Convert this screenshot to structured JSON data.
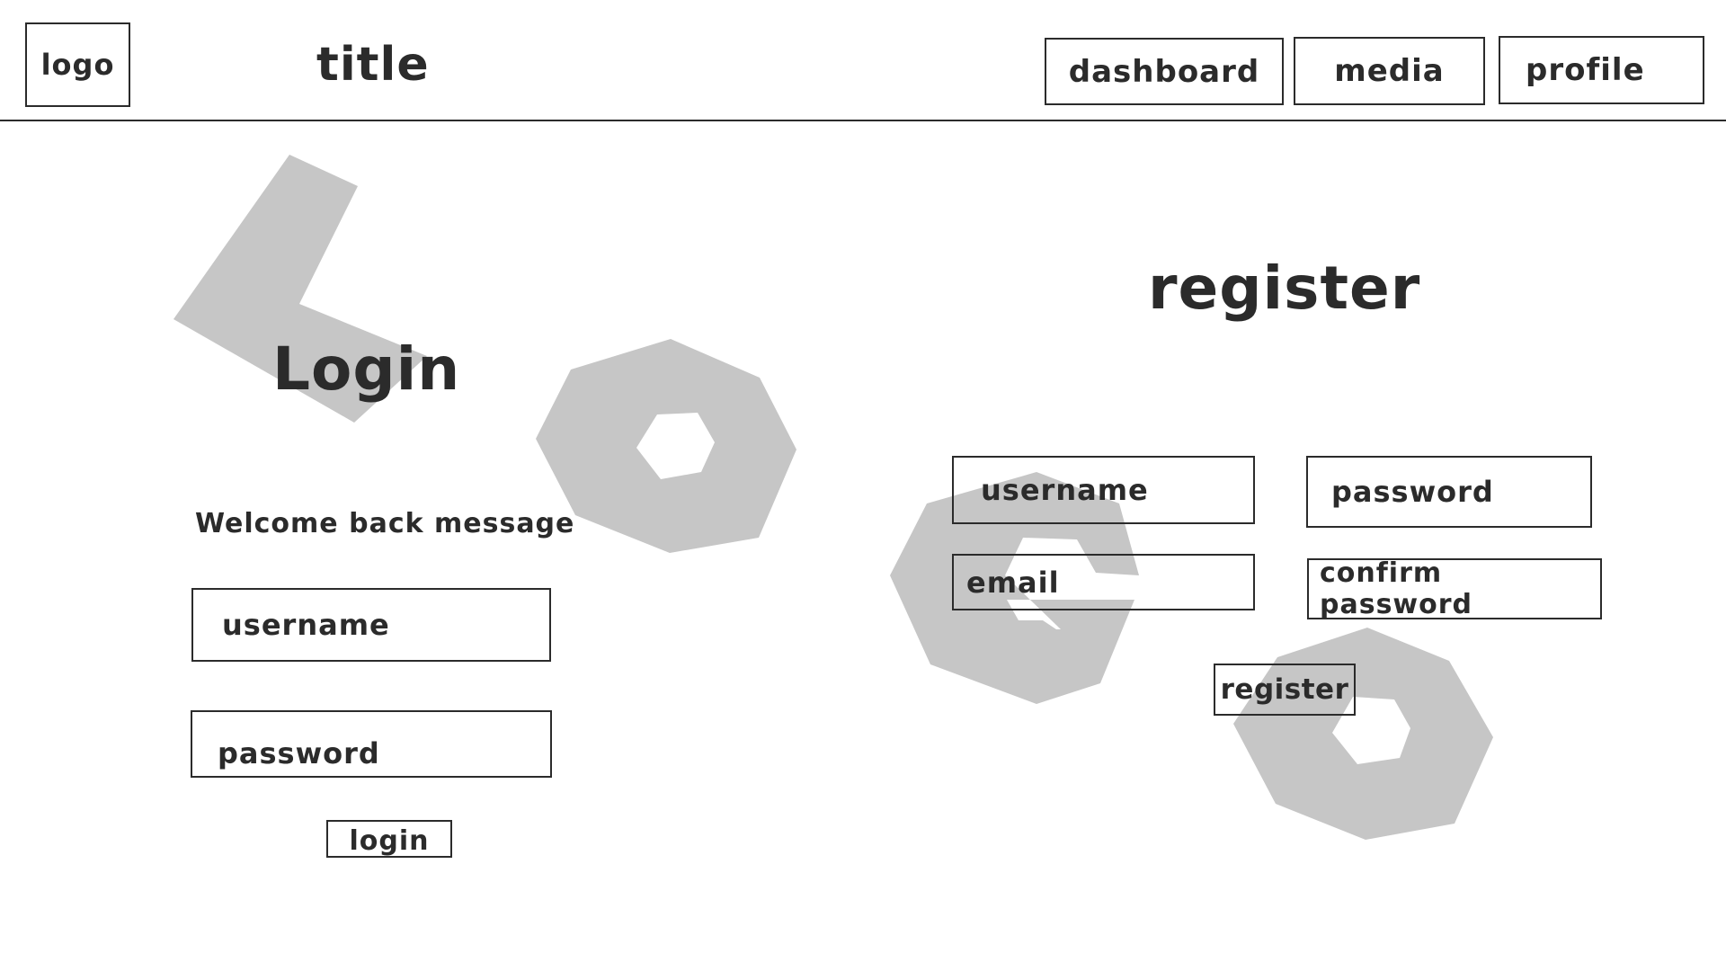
{
  "header": {
    "logo": "logo",
    "title": "title",
    "nav": {
      "dashboard": "dashboard",
      "media": "media",
      "profile": "profile"
    }
  },
  "watermark": {
    "text": "LOGO",
    "color": "#c6c6c6"
  },
  "login": {
    "heading": "Login",
    "welcome": "Welcome back message",
    "username_placeholder": "username",
    "password_placeholder": "password",
    "button": "login"
  },
  "register": {
    "heading": "register",
    "username_placeholder": "username",
    "password_placeholder": "password",
    "email_placeholder": "email",
    "confirm_password_placeholder": "confirm password",
    "button": "register"
  }
}
